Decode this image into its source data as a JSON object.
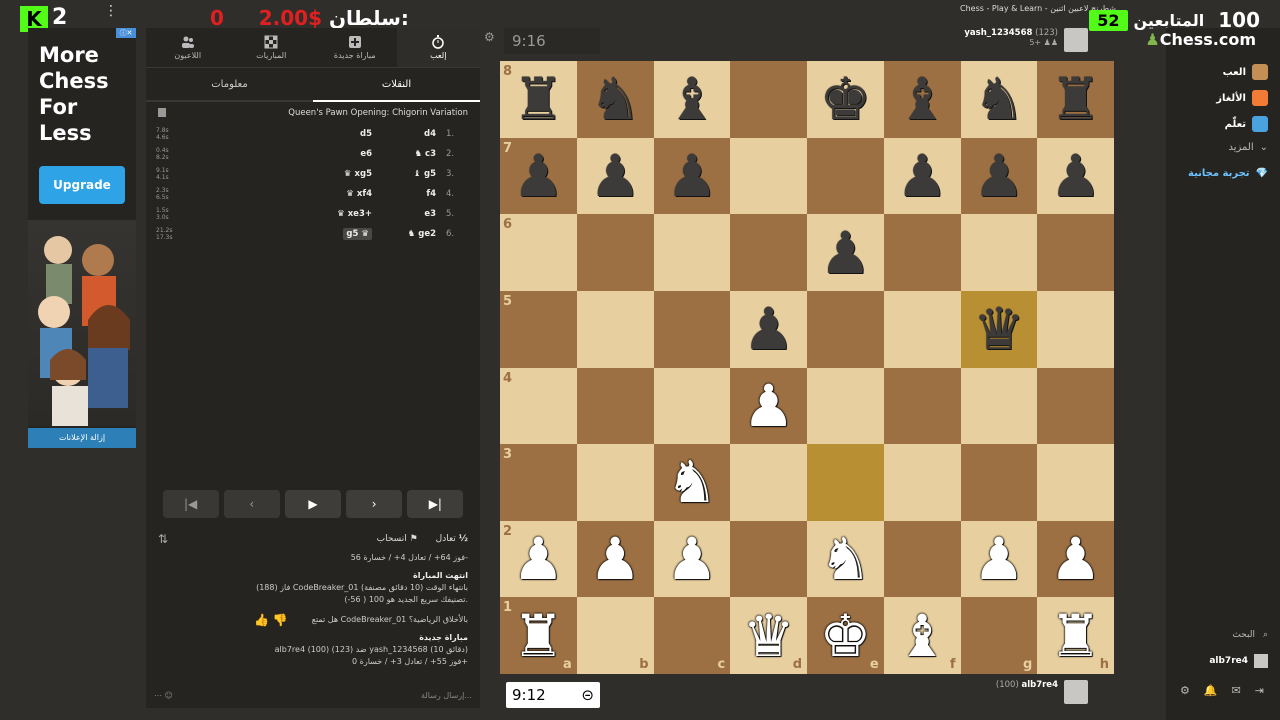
{
  "overlay": {
    "kick_letter": "K",
    "kick_count": "2",
    "sultan_amount": "2.00$",
    "sultan_label": "سلطان:",
    "sultan_prev": "0",
    "tab_title": "Chess - Play & Learn - شطرنج لاعبين اثنين",
    "followers_label": "المتابعين",
    "followers_count": "52",
    "followers_goal": "100"
  },
  "ad": {
    "title": "More Chess For Less",
    "upgrade": "Upgrade",
    "remove": "إزالة الإعلانات"
  },
  "panel": {
    "tabs": [
      {
        "label": "اللاعبون"
      },
      {
        "label": "المباريات"
      },
      {
        "label": "مباراة جديدة"
      },
      {
        "label": "إلعب"
      }
    ],
    "subtabs": [
      "معلومات",
      "النقلات"
    ],
    "opening": "Queen's Pawn Opening: Chigorin Variation",
    "moves": [
      {
        "num": "1.",
        "white": "d4",
        "black": "d5",
        "t1": "7.8s",
        "t2": "4.6s"
      },
      {
        "num": "2.",
        "white": "c3",
        "black": "e6",
        "t1": "0.4s",
        "t2": "8.2s"
      },
      {
        "num": "3.",
        "white": "g5",
        "black": "xg5",
        "t1": "9.1s",
        "t2": "4.1s"
      },
      {
        "num": "4.",
        "white": "f4",
        "black": "xf4",
        "t1": "2.3s",
        "t2": "6.5s"
      },
      {
        "num": "5.",
        "white": "e3",
        "black": "xe3+",
        "t1": "1.5s",
        "t2": "3.0s"
      },
      {
        "num": "6.",
        "white": "ge2",
        "black": "g5",
        "t1": "21.2s",
        "t2": "17.3s"
      }
    ],
    "draw": "تعادل",
    "resign": "انسحاب",
    "chat": {
      "stats1": "فوز 64+ / تعادل 4+ / خسارة 56-",
      "game_over": "انتهت المباراة",
      "result": "فاز (188) CodeBreaker_01 بانتهاء الوقت (10 دقائق مصنفة)",
      "rating": "تصنيفك سريع الجديد هو 100 ( 56-).",
      "sport": "هل تمتع CodeBreaker_01 بالأخلاق الرياضية؟",
      "new_game": "مباراة جديدة",
      "match": "alb7re4 (100) ضد (123) yash_1234568 (10 دقائق)",
      "stats2": "فوز 55+ / تعادل 3+ / خسارة 0+"
    },
    "input_placeholder": "إرسال رسالة..."
  },
  "game": {
    "clock_top": "9:16",
    "clock_bottom": "9:12",
    "top_player": {
      "name": "yash_1234568",
      "rating": "(123)",
      "captured": "5+"
    },
    "bottom_player": {
      "name": "alb7re4",
      "rating": "(100)"
    }
  },
  "nav": {
    "logo": "Chess.com",
    "items": [
      "العب",
      "الألغاز",
      "تعلّم",
      "المزيد",
      "تجربة مجانية"
    ],
    "search": "البحث",
    "user": "alb7re4"
  },
  "board": {
    "ranks": [
      "8",
      "7",
      "6",
      "5",
      "4",
      "3",
      "2",
      "1"
    ],
    "files": [
      "a",
      "b",
      "c",
      "d",
      "e",
      "f",
      "g",
      "h"
    ],
    "position": [
      [
        "br",
        "bn",
        "bb",
        "",
        "bk",
        "bb",
        "bn",
        "br"
      ],
      [
        "bp",
        "bp",
        "bp",
        "",
        "",
        "bp",
        "bp",
        "bp"
      ],
      [
        "",
        "",
        "",
        "",
        "bp",
        "",
        "",
        ""
      ],
      [
        "",
        "",
        "",
        "bp",
        "",
        "",
        "bq",
        ""
      ],
      [
        "",
        "",
        "",
        "wp",
        "",
        "",
        "",
        ""
      ],
      [
        "",
        "",
        "wn",
        "",
        "",
        "",
        "",
        ""
      ],
      [
        "wp",
        "wp",
        "wp",
        "",
        "wn",
        "",
        "wp",
        "wp"
      ],
      [
        "wr",
        "",
        "",
        "wq",
        "wk",
        "wb",
        "",
        "wr"
      ]
    ],
    "highlights": [
      "e3",
      "g5"
    ]
  }
}
